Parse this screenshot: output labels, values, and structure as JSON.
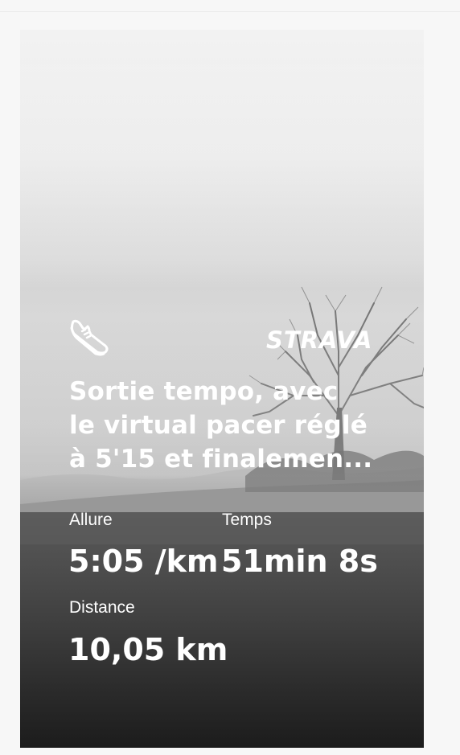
{
  "card": {
    "title_lines": [
      "Sortie tempo, avec",
      "le virtual pacer réglé",
      "à 5'15 et finalemen..."
    ],
    "brand": "STRAVA",
    "sport_icon": "running-shoe-icon",
    "stats": {
      "pace": {
        "label": "Allure",
        "value": "5:05 /km"
      },
      "time": {
        "label": "Temps",
        "value": "51min 8s"
      },
      "distance": {
        "label": "Distance",
        "value": "10,05 km"
      }
    }
  },
  "colors": {
    "text": "#ffffff",
    "page_background": "#f7f7f7",
    "card_top": "#f2f2f2",
    "card_bottom": "#1c1c1c"
  }
}
